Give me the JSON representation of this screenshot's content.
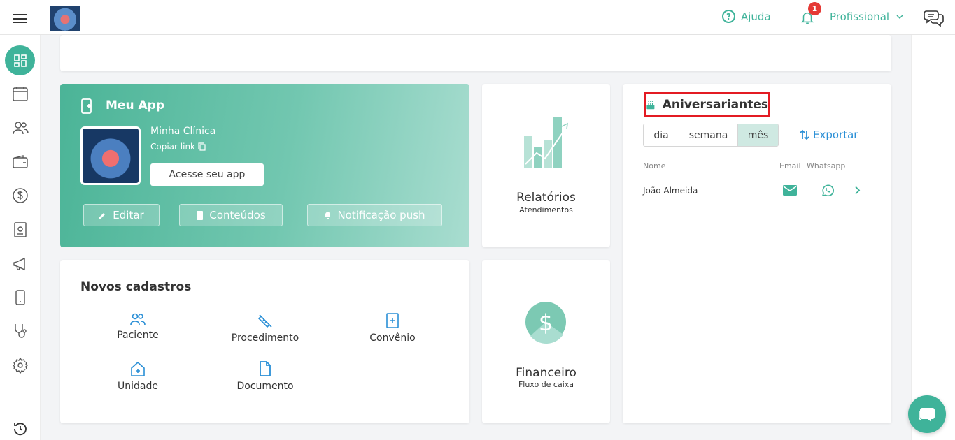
{
  "header": {
    "help_label": "Ajuda",
    "notification_count": "1",
    "profile_label": "Profissional"
  },
  "meu_app": {
    "title": "Meu App",
    "clinic_name": "Minha Clínica",
    "copy_link": "Copiar link",
    "access_button": "Acesse seu app",
    "buttons": {
      "edit": "Editar",
      "contents": "Conteúdos",
      "push": "Notificação push"
    }
  },
  "relatorios": {
    "title": "Relatórios",
    "subtitle": "Atendimentos"
  },
  "financeiro": {
    "title": "Financeiro",
    "subtitle": "Fluxo de caixa"
  },
  "novos_cadastros": {
    "title": "Novos cadastros",
    "items": {
      "paciente": "Paciente",
      "procedimento": "Procedimento",
      "convenio": "Convênio",
      "unidade": "Unidade",
      "documento": "Documento"
    }
  },
  "aniversariantes": {
    "title": "Aniversariantes",
    "periods": [
      "dia",
      "semana",
      "mês"
    ],
    "selected_period": "mês",
    "export_label": "Exportar",
    "columns": {
      "name": "Nome",
      "email": "Email",
      "whatsapp": "Whatsapp"
    },
    "rows": [
      {
        "name": "João Almeida"
      }
    ]
  },
  "colors": {
    "accent": "#3fb39a",
    "link": "#2a8fd6",
    "highlight_border": "#e31b23",
    "badge": "#e53935"
  }
}
